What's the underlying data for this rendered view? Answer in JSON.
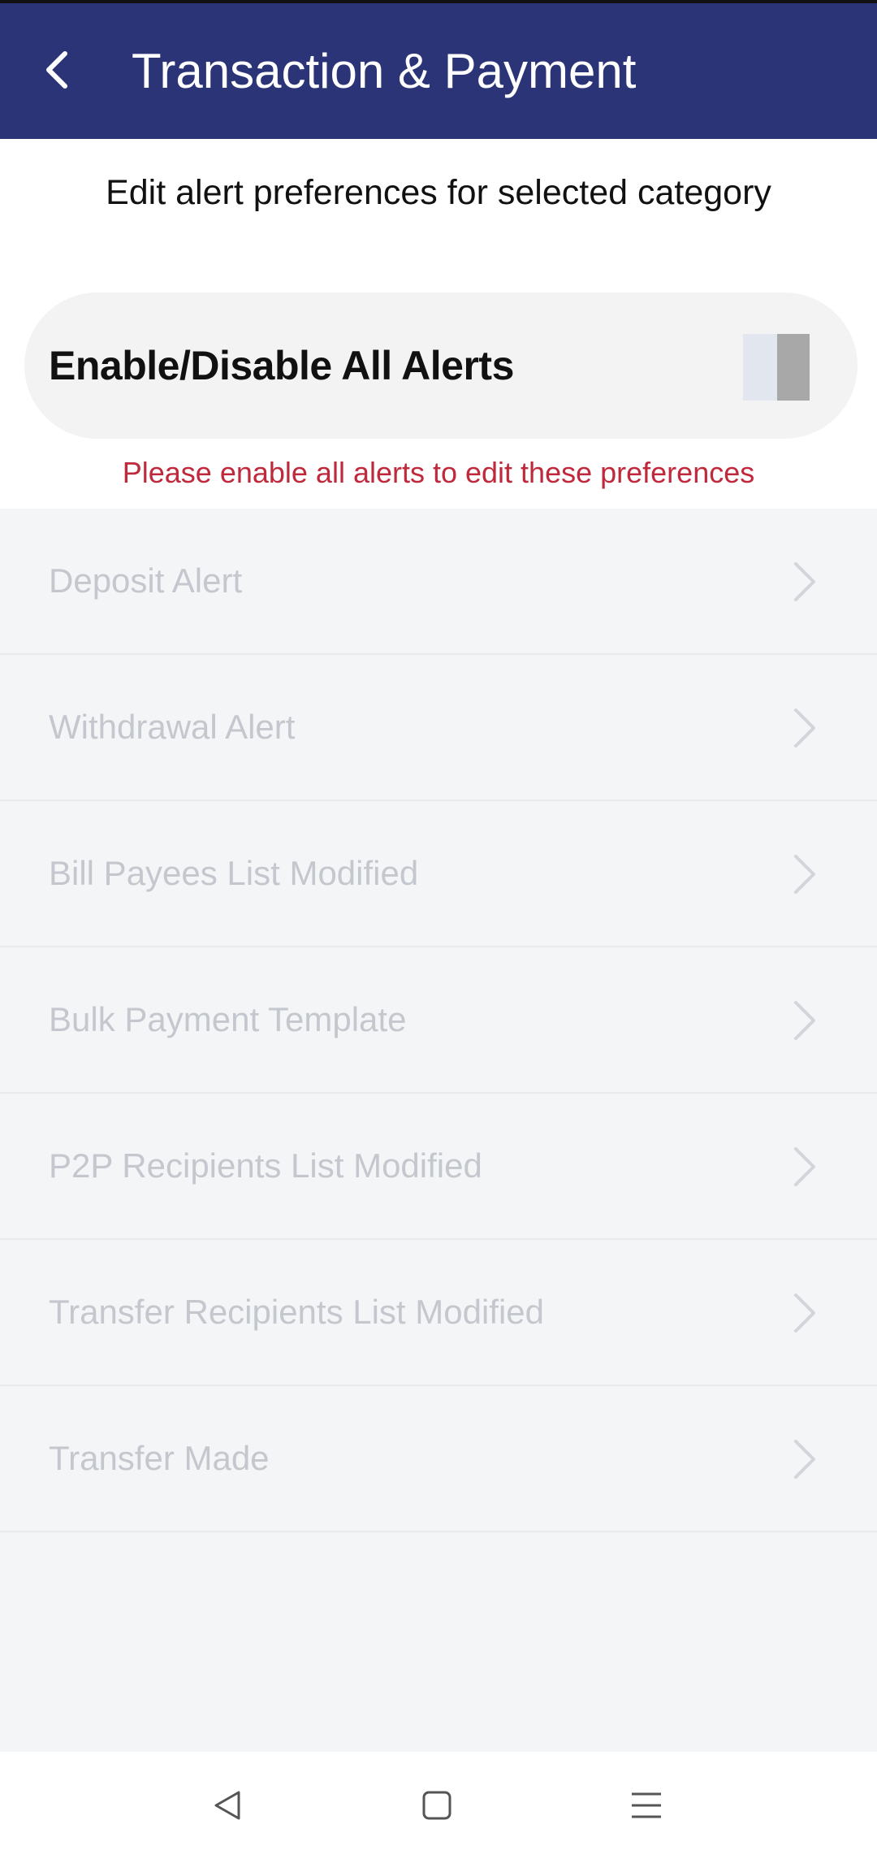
{
  "header": {
    "title": "Transaction & Payment",
    "back_icon": "chevron-left-icon",
    "background": "#2b3477"
  },
  "subtitle": "Edit alert preferences for selected category",
  "master_toggle": {
    "label": "Enable/Disable All Alerts",
    "state": "off"
  },
  "warning": {
    "text": "Please enable all alerts to edit these preferences",
    "color": "#c0293c"
  },
  "alerts": {
    "items": [
      {
        "label": "Deposit Alert"
      },
      {
        "label": "Withdrawal Alert"
      },
      {
        "label": "Bill Payees List Modified"
      },
      {
        "label": "Bulk Payment Template"
      },
      {
        "label": "P2P Recipients List Modified"
      },
      {
        "label": "Transfer Recipients List Modified"
      },
      {
        "label": "Transfer Made"
      }
    ],
    "disabled": true,
    "chevron_icon": "chevron-right-icon"
  },
  "nav": {
    "back_icon": "triangle-back-icon",
    "home_icon": "square-home-icon",
    "menu_icon": "hamburger-menu-icon"
  }
}
